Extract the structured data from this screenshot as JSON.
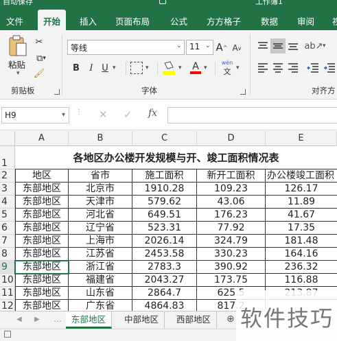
{
  "app": {
    "window_title": "自动保存",
    "doc_title": "工作簿1"
  },
  "ribbon_tabs": [
    {
      "label": "文件"
    },
    {
      "label": "开始",
      "active": true
    },
    {
      "label": "插入"
    },
    {
      "label": "页面布局"
    },
    {
      "label": "公式"
    },
    {
      "label": "方方格子"
    },
    {
      "label": "数据"
    },
    {
      "label": "审阅"
    },
    {
      "label": "视"
    }
  ],
  "clipboard": {
    "paste_label": "粘贴",
    "group_label": "剪贴板"
  },
  "font": {
    "name": "等线",
    "size": "11",
    "group_label": "字体",
    "bold": "B",
    "italic": "I",
    "underline": "U",
    "grow": "A",
    "shrink": "A",
    "fill_color": "#ffff00",
    "font_color": "#ff0000",
    "phonetic": "wén"
  },
  "alignment": {
    "group_label": "对齐方"
  },
  "formula_bar": {
    "name_box": "H9",
    "formula": ""
  },
  "sheet": {
    "columns": [
      "A",
      "B",
      "C",
      "D",
      "E"
    ],
    "title": "各地区办公楼开发规模与开、竣工面积情况表",
    "headers": [
      "地区",
      "省市",
      "施工面积",
      "新开工面积",
      "办公楼竣工面积"
    ],
    "rows": [
      {
        "num": "3",
        "cells": [
          "东部地区",
          "北京市",
          "1910.28",
          "109.23",
          "126.17"
        ]
      },
      {
        "num": "4",
        "cells": [
          "东部地区",
          "天津市",
          "579.62",
          "43.06",
          "11.89"
        ]
      },
      {
        "num": "5",
        "cells": [
          "东部地区",
          "河北省",
          "649.51",
          "176.23",
          "41.67"
        ]
      },
      {
        "num": "6",
        "cells": [
          "东部地区",
          "辽宁省",
          "523.31",
          "77.92",
          "17.35"
        ]
      },
      {
        "num": "7",
        "cells": [
          "东部地区",
          "上海市",
          "2026.14",
          "324.79",
          "181.48"
        ]
      },
      {
        "num": "8",
        "cells": [
          "东部地区",
          "江苏省",
          "2453.58",
          "330.23",
          "164.16"
        ]
      },
      {
        "num": "9",
        "cells": [
          "东部地区",
          "浙江省",
          "2783.3",
          "390.92",
          "236.32"
        ]
      },
      {
        "num": "10",
        "cells": [
          "东部地区",
          "福建省",
          "2043.27",
          "173.75",
          "116.88"
        ]
      },
      {
        "num": "11",
        "cells": [
          "东部地区",
          "山东省",
          "2864.7",
          "625.5",
          "213.87"
        ]
      },
      {
        "num": "12",
        "cells": [
          "东部地区",
          "广东省",
          "4864.83",
          "817.2",
          ""
        ]
      }
    ],
    "row1": "1",
    "row2": "2",
    "selected_row": "9"
  },
  "sheet_tabs": [
    {
      "label": "东部地区",
      "active": true
    },
    {
      "label": "中部地区"
    },
    {
      "label": "西部地区"
    }
  ],
  "watermark": "软件技巧"
}
